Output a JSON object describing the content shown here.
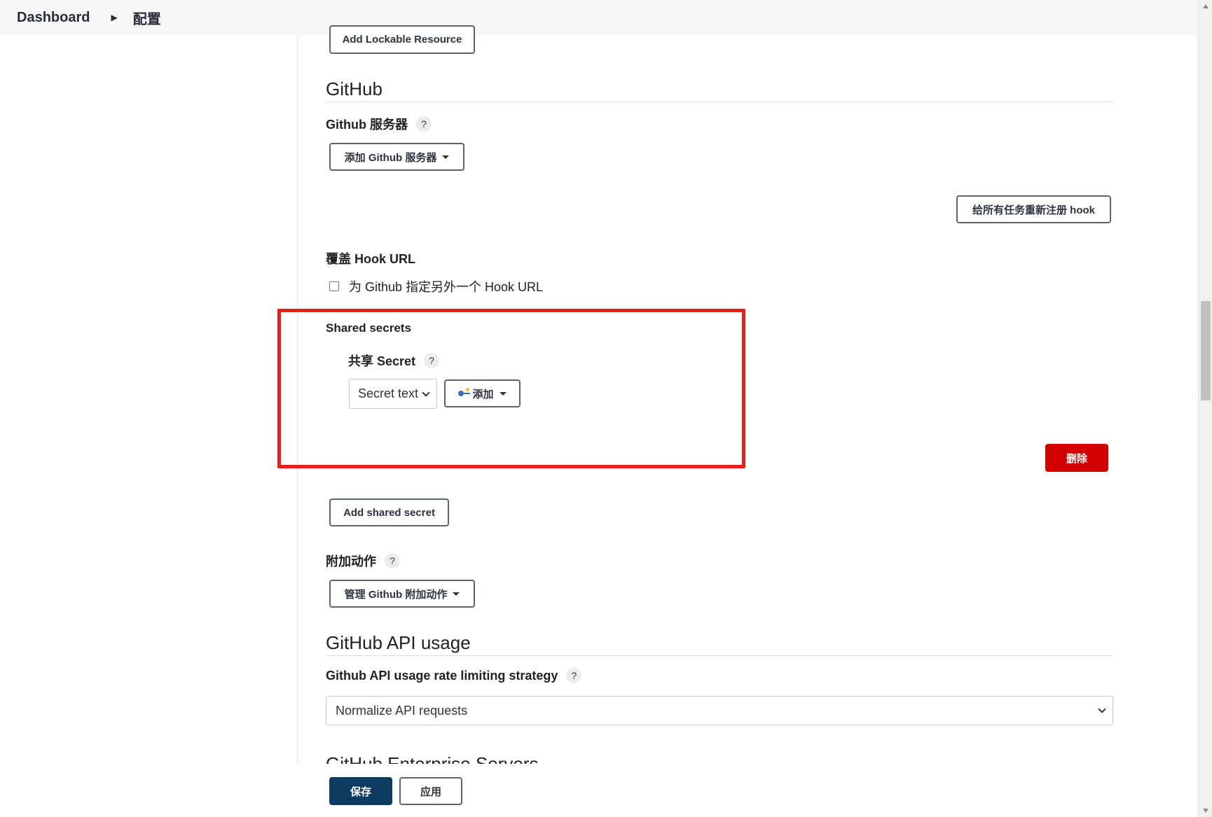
{
  "breadcrumb": {
    "items": [
      "Dashboard",
      "配置"
    ]
  },
  "lockable": {
    "add_button": "Add Lockable Resource"
  },
  "github": {
    "section_title": "GitHub",
    "servers_label": "Github 服务器",
    "add_server_button": "添加 Github 服务器",
    "reregister_hook_button": "给所有任务重新注册 hook",
    "override_hook_label": "覆盖 Hook URL",
    "override_hook_checkbox": "为 Github 指定另外一个 Hook URL",
    "override_hook_checked": false,
    "shared_secrets_label": "Shared secrets",
    "shared_secret_label": "共享 Secret",
    "secret_select_value": "Secret text",
    "add_credential_button": "添加",
    "delete_button": "删除",
    "add_shared_secret_button": "Add shared secret",
    "additional_actions_label": "附加动作",
    "manage_actions_button": "管理 Github 附加动作"
  },
  "api_usage": {
    "section_title": "GitHub API usage",
    "strategy_label": "Github API usage rate limiting strategy",
    "strategy_value": "Normalize API requests"
  },
  "enterprise": {
    "section_title": "GitHub Enterprise Servers"
  },
  "actions": {
    "save": "保存",
    "apply": "应用"
  },
  "help_glyph": "?",
  "colors": {
    "highlight_box": "#e8201c",
    "danger": "#d20000",
    "primary": "#0d3b62"
  }
}
